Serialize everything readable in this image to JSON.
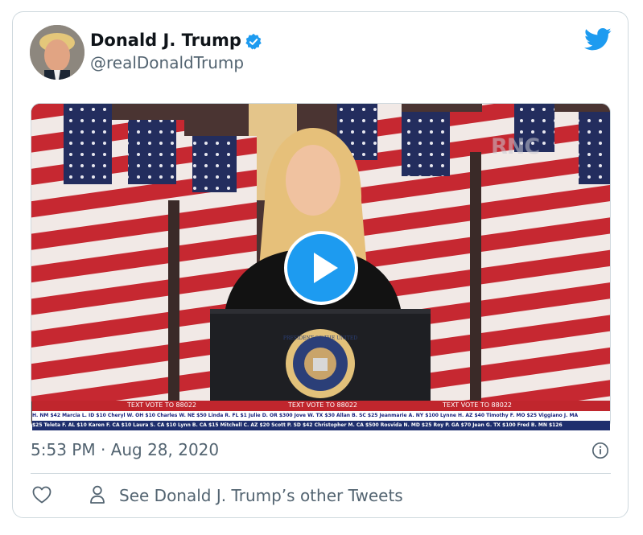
{
  "tweet": {
    "author_name": "Donald J. Trump",
    "author_handle": "@realDonaldTrump",
    "timestamp": "5:53 PM · Aug 28, 2020",
    "see_other_tweets": "See Donald J. Trump’s other Tweets"
  },
  "media": {
    "watermark": "RNC",
    "vote_banner": [
      "TEXT VOTE TO 88022",
      "TEXT VOTE TO 88022",
      "TEXT VOTE TO 88022"
    ],
    "ticker_row_1": "H. NM $42   Marcia L. ID $10   Cheryl W. OH $10   Charles W. NE $50   Linda R. FL $1   Julie D. OR $300   Jove W. TX $30   Allan B. SC $25   Jeanmarie A. NY $100   Lynne H. AZ $40   Timothy F. MO $25   Viggiano J. MA",
    "ticker_row_2": "$25   Teleta F. AL $10   Karen F. CA $10   Laura S. CA $10   Lynn B. CA $15   Mitchell C. AZ $20   Scott P. SD $42   Christopher M. CA $500   Rosvida N. MD $25   Roy P. GA $70   Jean G. TX $100   Fred B. MN $126",
    "seal_text": "PRESIDENT OF THE UNITED"
  },
  "colors": {
    "accent": "#1d9bf0",
    "text_secondary": "#536471",
    "border": "#cfd9de",
    "banner_red": "#c0262d",
    "ticker_navy": "#1f2f6e"
  },
  "icons": {
    "brand": "twitter-bird-icon",
    "verified": "verified-badge-icon",
    "info": "info-icon",
    "like": "heart-icon",
    "profile": "person-icon",
    "play": "play-icon"
  }
}
